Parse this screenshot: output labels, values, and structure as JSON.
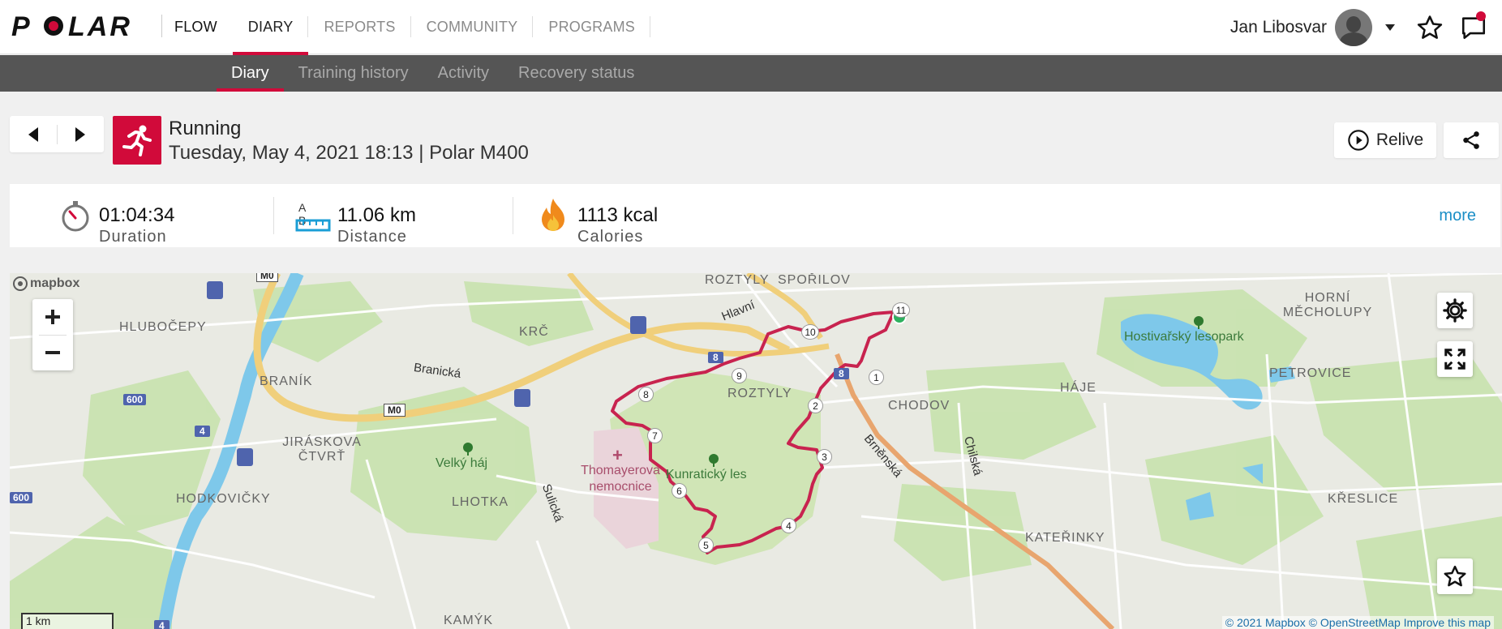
{
  "brand": {
    "logo_text": "POLAR"
  },
  "topnav": {
    "items": [
      {
        "label": "FLOW"
      },
      {
        "label": "DIARY"
      },
      {
        "label": "REPORTS"
      },
      {
        "label": "COMMUNITY"
      },
      {
        "label": "PROGRAMS"
      }
    ],
    "active": "DIARY",
    "user_name": "Jan Libosvar"
  },
  "subnav": {
    "items": [
      {
        "label": "Diary"
      },
      {
        "label": "Training history"
      },
      {
        "label": "Activity"
      },
      {
        "label": "Recovery status"
      }
    ],
    "active": "Diary"
  },
  "session": {
    "sport": "Running",
    "subtitle": "Tuesday, May 4, 2021 18:13 | Polar M400",
    "relive_label": "Relive"
  },
  "summary": {
    "duration_value": "01:04:34",
    "duration_label": "Duration",
    "distance_ab": "A B",
    "distance_value": "11.06 km",
    "distance_label": "Distance",
    "calories_value": "1113 kcal",
    "calories_label": "Calories",
    "more_label": "more"
  },
  "map": {
    "mapbox_label": "mapbox",
    "scale_label": "1 km",
    "attribution": "© 2021 Mapbox © OpenStreetMap Improve this map",
    "place_labels": [
      "HLUBOČEPY",
      "BRANÍK",
      "KRČ",
      "ROZTYLY",
      "SPOŘILOV",
      "ROZTYLY",
      "CHODOV",
      "HÁJE",
      "HORNÍ MĚCHOLUPY",
      "PETROVICE",
      "JIRÁSKOVA ČTVRŤ",
      "HODKOVIČKY",
      "LHOTKA",
      "KŘESLICE",
      "KATEŘINKY",
      "KAMÝK"
    ],
    "park_labels": [
      "Velký háj",
      "Kunratický les",
      "Hostivařský lesopark"
    ],
    "hospital_label": "Thomayerova nemocnice",
    "street_labels": [
      "Branická",
      "Hlavní",
      "Brněnská",
      "Chilská",
      "Sulická"
    ],
    "road_shields": [
      "M0",
      "M0",
      "8",
      "8",
      "600",
      "600",
      "4",
      "4"
    ],
    "km_markers": [
      "1",
      "2",
      "3",
      "4",
      "5",
      "6",
      "7",
      "8",
      "9",
      "10",
      "11"
    ],
    "route_color": "#c8234f"
  },
  "colors": {
    "accent": "#d10a3a",
    "link": "#1a8ec6",
    "subnav_bg": "#555555"
  }
}
